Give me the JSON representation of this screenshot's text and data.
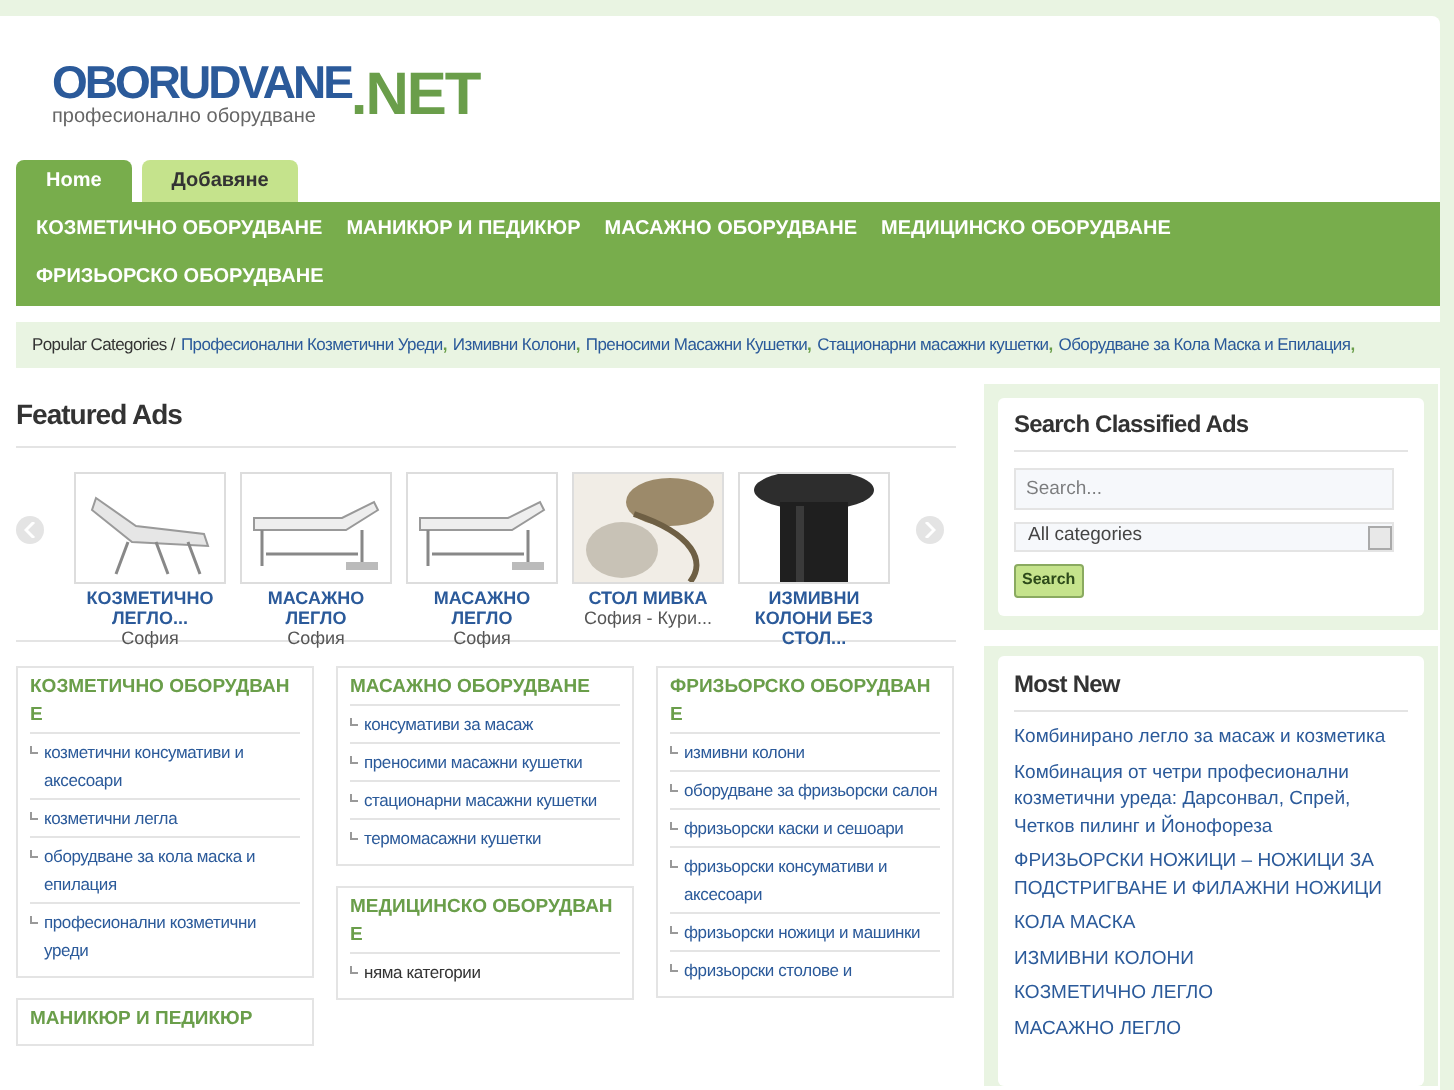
{
  "logo": {
    "name": "OBORUDVANE",
    "tld": ".NET",
    "tagline": "професионално оборудване"
  },
  "tabs": [
    {
      "label": "Home",
      "selected": true
    },
    {
      "label": "Добавяне",
      "selected": false
    }
  ],
  "nav": [
    "КОЗМЕТИЧНО ОБОРУДВАНЕ",
    "МАНИКЮР И ПЕДИКЮР",
    "МАСАЖНО ОБОРУДВАНЕ",
    "МЕДИЦИНСКО ОБОРУДВАНЕ",
    "ФРИЗЬОРСКО ОБОРУДВАНЕ"
  ],
  "breadcrumb": {
    "label": "Popular Categories /",
    "separator": ",",
    "links": [
      "Професионални Козметични Уреди",
      "Измивни Колони",
      "Преносими Масажни Кушетки",
      "Стационарни масажни кушетки",
      "Оборудване за Кола Маска и Епилация"
    ]
  },
  "featured": {
    "title": "Featured Ads",
    "ads": [
      {
        "kind": "chair",
        "title": "КОЗМЕТИЧНО ЛЕГЛО...",
        "location": "София"
      },
      {
        "kind": "bed",
        "title": "МАСАЖНО ЛЕГЛО",
        "location": "София"
      },
      {
        "kind": "bed",
        "title": "МАСАЖНО ЛЕГЛО",
        "location": "София"
      },
      {
        "kind": "sink",
        "title": "СТОЛ МИВКА",
        "location": "София - Кури..."
      },
      {
        "kind": "column",
        "title": "ИЗМИВНИ КОЛОНИ БЕЗ СТОЛ..."
      }
    ]
  },
  "category_columns": [
    [
      {
        "title": "КОЗМЕТИЧНО ОБОРУДВАНЕ",
        "items": [
          {
            "label": "козметични консумативи и аксесоари",
            "empty": false
          },
          {
            "label": "козметични легла",
            "empty": false
          },
          {
            "label": "оборудване за кола маска и епилация",
            "empty": false
          },
          {
            "label": "професионални козметични уреди",
            "empty": false
          }
        ]
      },
      {
        "title": "МАНИКЮР И ПЕДИКЮР"
      }
    ],
    [
      {
        "title": "МАСАЖНО ОБОРУДВАНЕ",
        "items": [
          {
            "label": "консумативи за масаж",
            "empty": false
          },
          {
            "label": "преносими масажни кушетки",
            "empty": false
          },
          {
            "label": "стационарни масажни кушетки",
            "empty": false
          },
          {
            "label": "термомасажни кушетки",
            "empty": false
          }
        ]
      },
      {
        "title": "МЕДИЦИНСКО ОБОРУДВАНЕ",
        "items": [
          {
            "label": "няма категории",
            "empty": true
          }
        ]
      }
    ],
    [
      {
        "title": "ФРИЗЬОРСКО ОБОРУДВАНЕ",
        "items": [
          {
            "label": "измивни колони",
            "empty": false
          },
          {
            "label": "оборудване за фризьорски салон",
            "empty": false
          },
          {
            "label": "фризьорски каски и сешоари",
            "empty": false
          },
          {
            "label": "фризьорски консумативи и аксесоари",
            "empty": false
          },
          {
            "label": "фризьорски ножици и машинки",
            "empty": false
          },
          {
            "label": "фризьорски столове и",
            "empty": false
          }
        ]
      }
    ]
  ],
  "search": {
    "title": "Search Classified Ads",
    "placeholder": "Search...",
    "category": "All categories",
    "button": "Search"
  },
  "most_new": {
    "title": "Most New",
    "items": [
      "Комбинирано легло за масаж и козметика",
      "Комбинация от четри професионални козметични уреда: Дарсонвал, Спрей, Четков пилинг и Йонофореза",
      "ФРИЗЬОРСКИ НОЖИЦИ – НОЖИЦИ ЗА ПОДСТРИГВАНЕ И ФИЛАЖНИ НОЖИЦИ",
      "КОЛА МАСКА",
      "ИЗМИВНИ КОЛОНИ",
      "КОЗМЕТИЧНО ЛЕГЛО",
      "МАСАЖНО ЛЕГЛО"
    ]
  }
}
